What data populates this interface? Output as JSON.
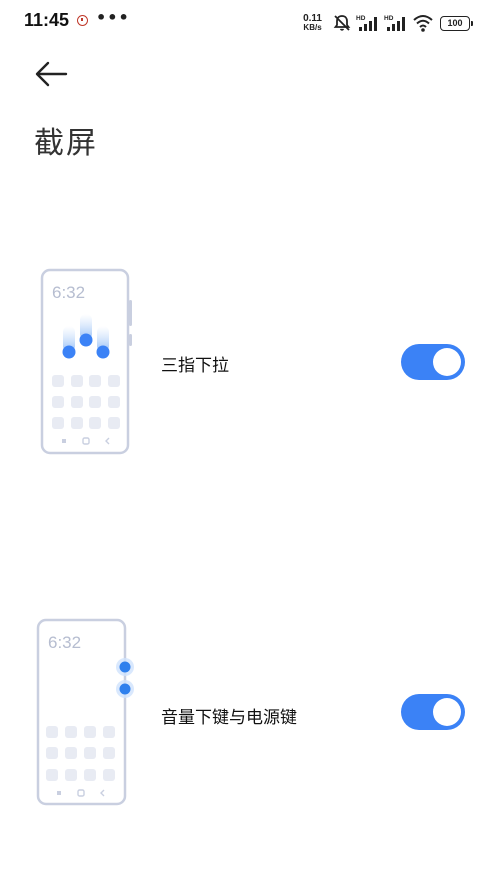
{
  "status_bar": {
    "time": "11:45",
    "more": "•••",
    "net_speed_value": "0.11",
    "net_speed_unit": "KB/s",
    "signal1_label": "HD",
    "signal2_label": "HD",
    "battery": "100",
    "icons": [
      "app-notification-icon",
      "mute-icon",
      "signal-icon",
      "signal-icon",
      "wifi-icon",
      "battery-icon"
    ]
  },
  "header": {
    "back_icon": "arrow-left-icon",
    "title": "截屏"
  },
  "options": [
    {
      "label": "三指下拉",
      "illustration_time": "6:32",
      "enabled": true
    },
    {
      "label": "音量下键与电源键",
      "illustration_time": "6:32",
      "enabled": true
    }
  ],
  "colors": {
    "accent": "#3b82f6",
    "illustration_outline": "#c9cfe0",
    "illustration_tile": "#e8ebf3",
    "dot": "#2f80ed"
  }
}
